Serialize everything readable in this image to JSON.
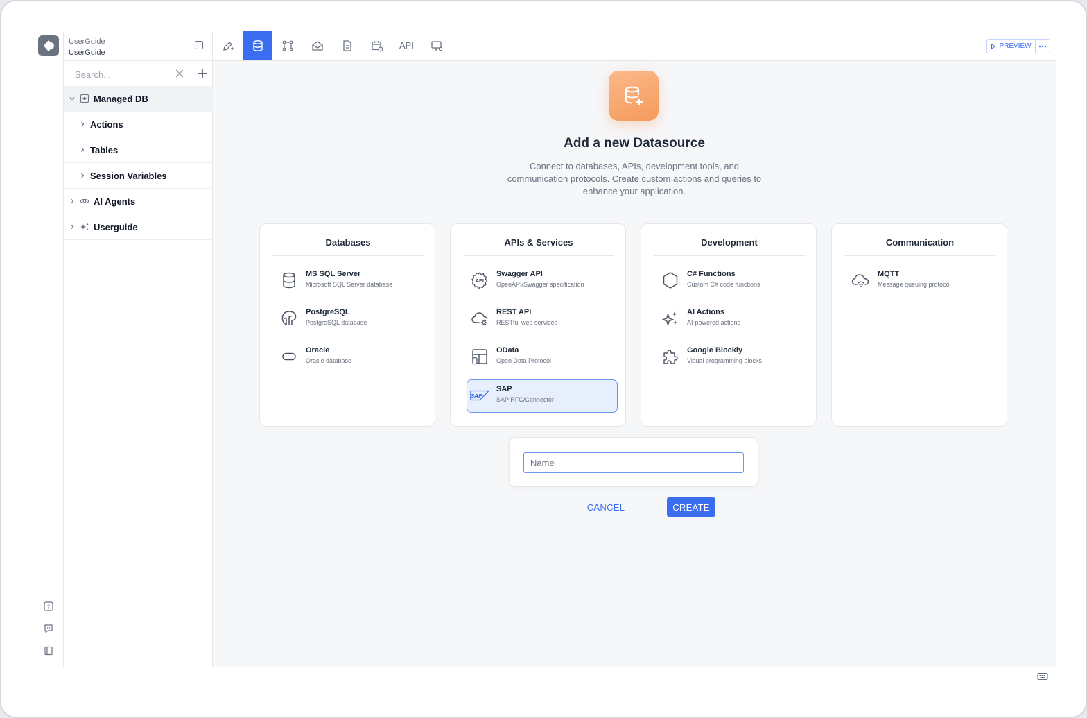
{
  "sidebar": {
    "project_line1": "UserGuide",
    "project_line2": "UserGuide",
    "search_placeholder": "Search...",
    "tree": [
      {
        "label": "Managed DB",
        "level": 0,
        "expanded": true,
        "selected": true,
        "icon": "database-box-icon"
      },
      {
        "label": "Actions",
        "level": 1,
        "expanded": false
      },
      {
        "label": "Tables",
        "level": 1,
        "expanded": false
      },
      {
        "label": "Session Variables",
        "level": 1,
        "expanded": false
      },
      {
        "label": "AI Agents",
        "level": 0,
        "expanded": false,
        "icon": "eye-icon"
      },
      {
        "label": "Userguide",
        "level": 0,
        "expanded": false,
        "icon": "sparkle-icon"
      }
    ]
  },
  "toolbar": {
    "api_label": "API",
    "preview_label": "PREVIEW",
    "active_tab": "datasource",
    "accent_color": "#3b6df0"
  },
  "main": {
    "title": "Add a new Datasource",
    "subtitle": "Connect to databases, APIs, development tools, and communication protocols. Create custom actions and queries to enhance your application.",
    "categories": [
      {
        "title": "Databases",
        "items": [
          {
            "name": "MS SQL Server",
            "desc": "Microsoft SQL Server database",
            "icon": "database-icon"
          },
          {
            "name": "PostgreSQL",
            "desc": "PostgreSQL database",
            "icon": "elephant-icon"
          },
          {
            "name": "Oracle",
            "desc": "Oracle database",
            "icon": "oracle-icon"
          }
        ]
      },
      {
        "title": "APIs & Services",
        "items": [
          {
            "name": "Swagger API",
            "desc": "OpenAPI/Swagger specification",
            "icon": "api-gear-icon"
          },
          {
            "name": "REST API",
            "desc": "RESTful web services",
            "icon": "cloud-gear-icon"
          },
          {
            "name": "OData",
            "desc": "Open Data Protocol",
            "icon": "odata-icon"
          },
          {
            "name": "SAP",
            "desc": "SAP RFC/Connector",
            "icon": "sap-icon",
            "selected": true
          }
        ]
      },
      {
        "title": "Development",
        "items": [
          {
            "name": "C# Functions",
            "desc": "Custom C# code functions",
            "icon": "hexagon-icon"
          },
          {
            "name": "AI Actions",
            "desc": "AI-powered actions",
            "icon": "sparkles-icon"
          },
          {
            "name": "Google Blockly",
            "desc": "Visual programming blocks",
            "icon": "puzzle-icon"
          }
        ]
      },
      {
        "title": "Communication",
        "items": [
          {
            "name": "MQTT",
            "desc": "Message queuing protocol",
            "icon": "cloud-wifi-icon"
          }
        ]
      }
    ],
    "name_placeholder": "Name",
    "name_value": "",
    "cancel_label": "CANCEL",
    "create_label": "CREATE",
    "hero_color": "#f59a5c"
  }
}
